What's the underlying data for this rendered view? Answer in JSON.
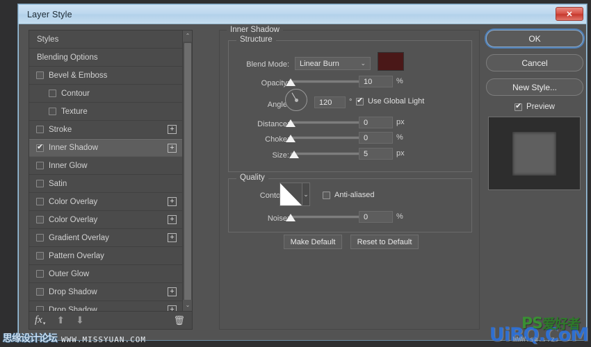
{
  "window": {
    "title": "Layer Style",
    "close_label": "✕"
  },
  "styles_panel": {
    "items": [
      {
        "label": "Styles",
        "type": "header",
        "checkbox": "none",
        "plus": false,
        "selected": false
      },
      {
        "label": "Blending Options",
        "type": "header",
        "checkbox": "none",
        "plus": false,
        "selected": false
      },
      {
        "label": "Bevel & Emboss",
        "type": "normal",
        "checkbox": "unchecked",
        "plus": false,
        "selected": false
      },
      {
        "label": "Contour",
        "type": "indent",
        "checkbox": "sub",
        "plus": false,
        "selected": false
      },
      {
        "label": "Texture",
        "type": "indent",
        "checkbox": "sub",
        "plus": false,
        "selected": false
      },
      {
        "label": "Stroke",
        "type": "normal",
        "checkbox": "sub",
        "plus": true,
        "selected": false
      },
      {
        "label": "Inner Shadow",
        "type": "normal",
        "checkbox": "checked",
        "plus": true,
        "selected": true
      },
      {
        "label": "Inner Glow",
        "type": "normal",
        "checkbox": "sub",
        "plus": false,
        "selected": false
      },
      {
        "label": "Satin",
        "type": "normal",
        "checkbox": "sub",
        "plus": false,
        "selected": false
      },
      {
        "label": "Color Overlay",
        "type": "normal",
        "checkbox": "sub",
        "plus": true,
        "selected": false
      },
      {
        "label": "Color Overlay",
        "type": "normal",
        "checkbox": "unchecked",
        "plus": true,
        "selected": false
      },
      {
        "label": "Gradient Overlay",
        "type": "normal",
        "checkbox": "sub",
        "plus": true,
        "selected": false
      },
      {
        "label": "Pattern Overlay",
        "type": "normal",
        "checkbox": "unchecked",
        "plus": false,
        "selected": false
      },
      {
        "label": "Outer Glow",
        "type": "normal",
        "checkbox": "sub",
        "plus": false,
        "selected": false
      },
      {
        "label": "Drop Shadow",
        "type": "normal",
        "checkbox": "unchecked",
        "plus": true,
        "selected": false
      },
      {
        "label": "Drop Shadow",
        "type": "normal",
        "checkbox": "sub",
        "plus": true,
        "selected": false
      }
    ],
    "footer": {
      "fx_label": "fx",
      "caret": "▾",
      "move_up": "⬆",
      "move_down": "⬇",
      "delete": "🗑"
    },
    "scrollbar": {
      "up": "⌃",
      "down": "⌄"
    }
  },
  "settings": {
    "effect_title": "Inner Shadow",
    "structure": {
      "title": "Structure",
      "blend_mode_label": "Blend Mode:",
      "blend_mode_value": "Linear Burn",
      "blend_mode_caret": "⌄",
      "color_swatch": "#4a1818",
      "opacity_label": "Opacity:",
      "opacity_value": "10",
      "opacity_unit": "%",
      "angle_label": "Angle:",
      "angle_value": "120",
      "angle_unit": "°",
      "use_global_light_label": "Use Global Light",
      "use_global_light_checked": true,
      "distance_label": "Distance:",
      "distance_value": "0",
      "distance_unit": "px",
      "choke_label": "Choke:",
      "choke_value": "0",
      "choke_unit": "%",
      "size_label": "Size:",
      "size_value": "5",
      "size_unit": "px"
    },
    "quality": {
      "title": "Quality",
      "contour_label": "Contour:",
      "contour_caret": "⌄",
      "anti_aliased_label": "Anti-aliased",
      "anti_aliased_checked": false,
      "noise_label": "Noise:",
      "noise_value": "0",
      "noise_unit": "%"
    },
    "make_default_label": "Make Default",
    "reset_default_label": "Reset to Default"
  },
  "right_panel": {
    "ok_label": "OK",
    "cancel_label": "Cancel",
    "new_style_label": "New Style...",
    "preview_label": "Preview",
    "preview_checked": true
  },
  "watermarks": {
    "left_cn": "思缘设计论坛",
    "left_url": "WWW.MISSYUAN.COM",
    "right_ps": "PS",
    "right_cn": "爱好者",
    "right_sub": "WWW.sa...z.",
    "right_brand": "UiBQ.CoM"
  }
}
